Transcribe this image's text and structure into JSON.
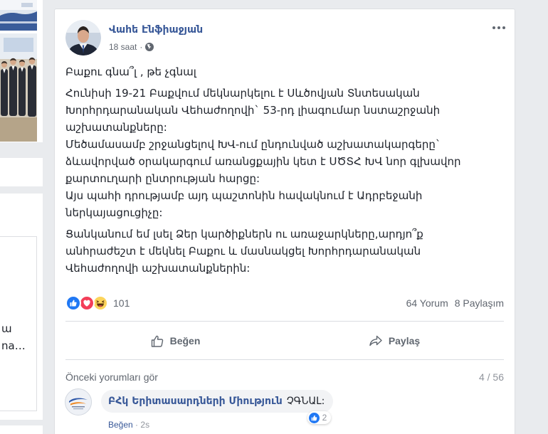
{
  "left_column": {
    "snippet_lines": [
      "ա",
      "na…"
    ]
  },
  "post": {
    "author": "Վահե Էնֆիաջյան",
    "avatar_icon": "author-avatar",
    "time": "18 saat",
    "separator": "·",
    "privacy_icon": "globe-icon",
    "more_icon": "more-horizontal-icon",
    "paragraphs": [
      [
        "Բաքու գնա՞լ , թե չգնալ"
      ],
      [
        "Հունիսի 19-21 Բաքվում մեկնարկելու է Սևծովյան Տնտեսական",
        "Խորհրդարանական Վեհաժողովի` 53-րդ լիագումար նստաշրջանի",
        "աշխատանքները:",
        "Մեծամասամբ շրջանցելով ԽՎ-ում ընդունված աշխատակարգերը`",
        "ձևավորված օրակարգում առանցքային կետ է ՍԾՏՀ ԽՎ նոր գլխավոր",
        "քարտուղարի ընտրության հարցը:",
        "Այս պահի դրությամբ այդ պաշտոնին հավակնում է Ադրբեջանի",
        "ներկայացուցիչը:"
      ],
      [
        "Ցանկանում եմ լսել Ձեր կարծիքներն ու առաջարկները,արդյո՞ք",
        "անհրաժեշտ է մեկնել Բաքու և մասնակցել Խորհրդարանական",
        "Վեհաժողովի աշխատանքներին:"
      ]
    ],
    "reactions": {
      "icons": [
        "like-reaction-icon",
        "love-reaction-icon",
        "haha-reaction-icon"
      ],
      "count": "101",
      "comments": "64 Yorum",
      "shares": "8 Paylaşım"
    },
    "actions": {
      "like": {
        "icon": "thumbs-up-icon",
        "label": "Beğen"
      },
      "share": {
        "icon": "share-arrow-icon",
        "label": "Paylaş"
      }
    }
  },
  "comments": {
    "previous_label": "Önceki yorumları gör",
    "pager": "4 / 56",
    "items": [
      {
        "avatar_icon": "organization-logo-avatar",
        "author": "ԲՀկ Երիտասարդների Միություն",
        "text": "ՉԳՆԱԼ:",
        "reaction_icon": "like-reaction-icon",
        "reaction_count": "2",
        "like_label": "Beğen",
        "separator": "·",
        "time": "2s"
      }
    ]
  },
  "colors": {
    "page_background": "#e9ebee",
    "link_blue": "#385898",
    "like_blue": "#2078f4",
    "love_red": "#f33e58",
    "haha_yellow": "#fcd45b",
    "secondary_text": "#616770"
  }
}
